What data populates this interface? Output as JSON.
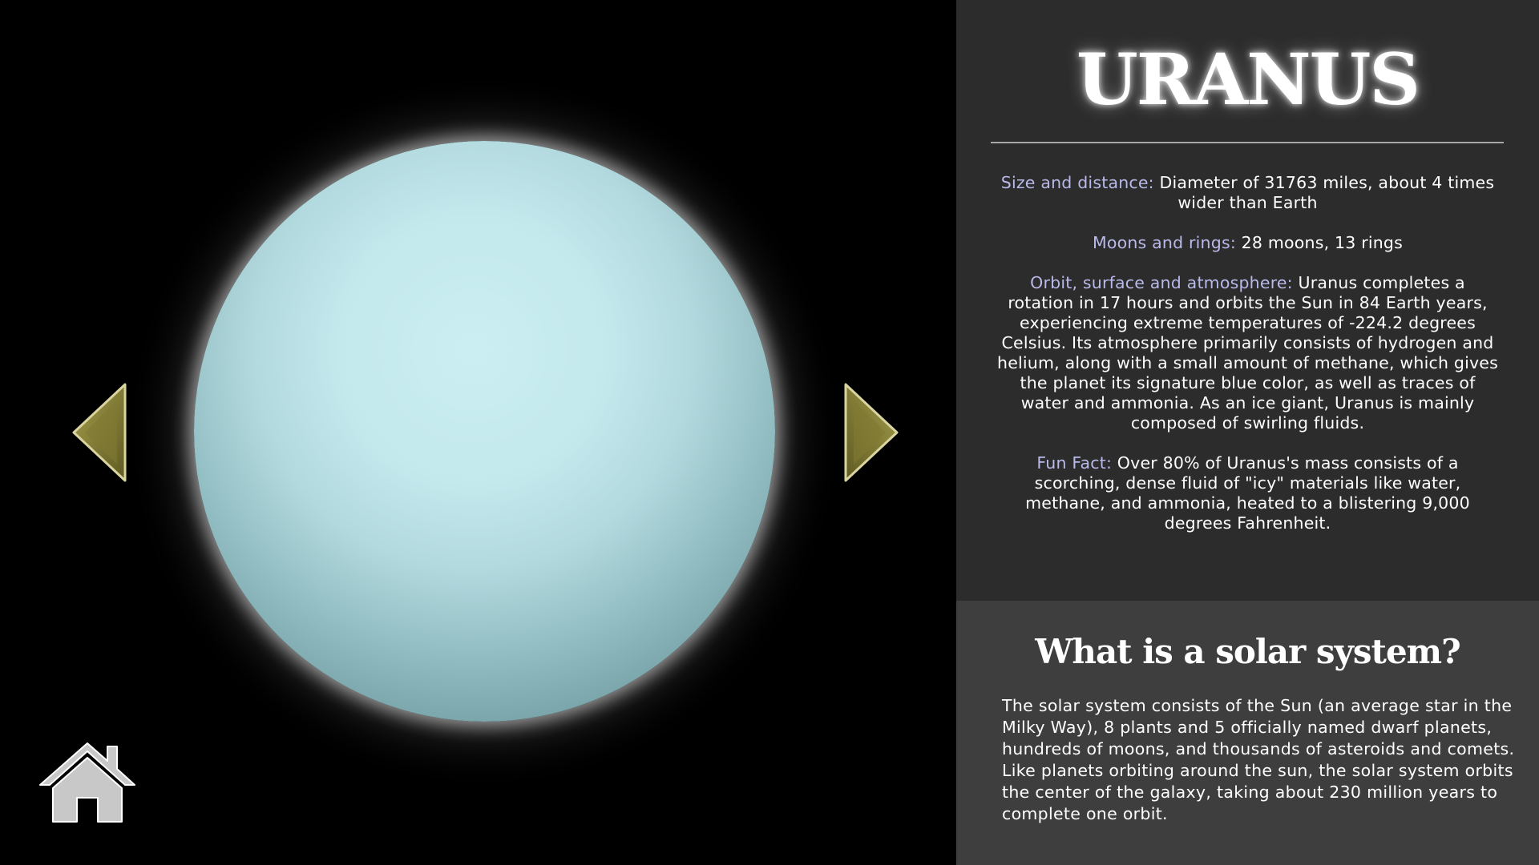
{
  "planet": {
    "name": "URANUS",
    "icon": "uranus-planet-image"
  },
  "navigation": {
    "previous_icon": "left-arrow-icon",
    "next_icon": "right-arrow-icon",
    "home_icon": "home-icon"
  },
  "facts": [
    {
      "label": "Size and distance:",
      "text": " Diameter of 31763 miles, about 4 times wider than Earth"
    },
    {
      "label": "Moons and rings:",
      "text": " 28 moons, 13 rings"
    },
    {
      "label": "Orbit, surface and atmosphere:",
      "text": " Uranus completes a rotation in 17 hours and orbits the Sun in 84 Earth years, experiencing extreme temperatures of -224.2 degrees Celsius. Its atmosphere primarily consists of hydrogen and helium, along with a small amount of methane, which gives the planet its signature blue color, as well as traces of water and ammonia. As an ice giant, Uranus is mainly composed of swirling fluids."
    },
    {
      "label": "Fun Fact:",
      "text": " Over 80% of Uranus's mass consists of a scorching, dense fluid of \"icy\" materials like water, methane, and ammonia, heated to a blistering 9,000 degrees Fahrenheit."
    }
  ],
  "solar_system": {
    "title": "What is a solar system?",
    "body": "The solar system consists of the Sun (an average star in the Milky Way), 8 plants and 5 officially named dwarf planets, hundreds of moons, and thousands of asteroids and comets. Like planets orbiting around the sun, the solar system orbits the center of the galaxy, taking about 230 million years to complete one orbit."
  },
  "colors": {
    "label_accent": "#b9b9ea",
    "panel_top": "#2c2c2c",
    "panel_bottom": "#3e3e3e",
    "arrow_gold": "#8f8a3a",
    "home_gray": "#c8c8c8"
  }
}
